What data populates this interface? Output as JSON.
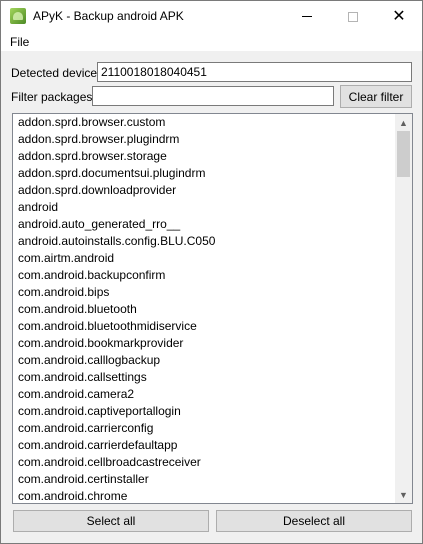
{
  "window": {
    "title": "APyK - Backup android APK",
    "icon": "android-app-icon",
    "controls": {
      "minimize": "minimize-icon",
      "maximize": "maximize-icon",
      "close": "close-icon"
    }
  },
  "menubar": {
    "items": [
      "File"
    ]
  },
  "device": {
    "label": "Detected device:",
    "value": "2110018018040451"
  },
  "filter": {
    "label": "Filter packages:",
    "value": "",
    "clear_label": "Clear filter"
  },
  "packages": [
    "addon.sprd.browser.custom",
    "addon.sprd.browser.plugindrm",
    "addon.sprd.browser.storage",
    "addon.sprd.documentsui.plugindrm",
    "addon.sprd.downloadprovider",
    "android",
    "android.auto_generated_rro__",
    "android.autoinstalls.config.BLU.C050",
    "com.airtm.android",
    "com.android.backupconfirm",
    "com.android.bips",
    "com.android.bluetooth",
    "com.android.bluetoothmidiservice",
    "com.android.bookmarkprovider",
    "com.android.calllogbackup",
    "com.android.callsettings",
    "com.android.camera2",
    "com.android.captiveportallogin",
    "com.android.carrierconfig",
    "com.android.carrierdefaultapp",
    "com.android.cellbroadcastreceiver",
    "com.android.certinstaller",
    "com.android.chrome"
  ],
  "actions": {
    "select_all": "Select all",
    "deselect_all": "Deselect all"
  }
}
